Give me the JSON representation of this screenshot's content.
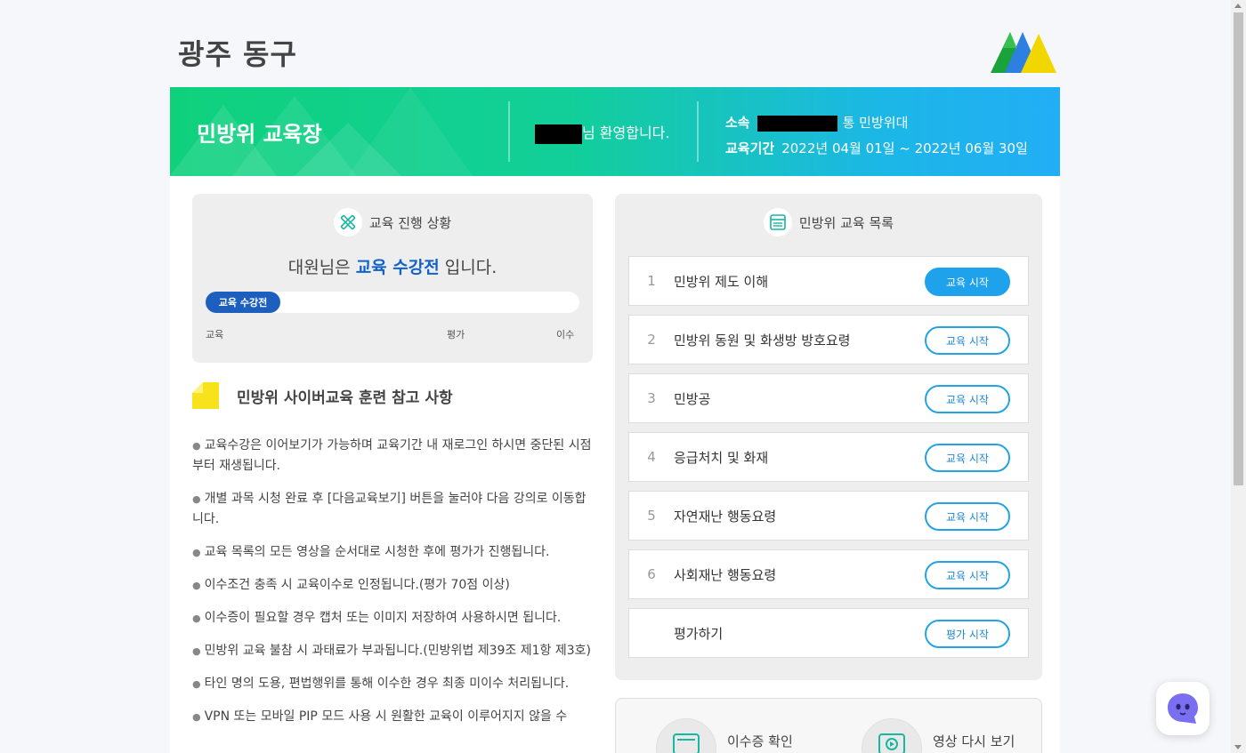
{
  "header": {
    "site_title": "광주 동구"
  },
  "banner": {
    "title": "민방위 교육장",
    "welcome_suffix": "님 환영합니다.",
    "affiliation_label": "소속",
    "affiliation_suffix": "통 민방위대",
    "period_label": "교육기간",
    "period_value": "2022년 04월 01일 ~ 2022년 06월 30일"
  },
  "progress": {
    "heading": "교육 진행 상황",
    "status_prefix": "대원님은 ",
    "status_highlight": "교육 수강전",
    "status_suffix": " 입니다.",
    "bar_label": "교육 수강전",
    "bar_fraction": 0.2,
    "stages": [
      "교육",
      "평가",
      "이수"
    ]
  },
  "notice": {
    "title": "민방위 사이버교육 훈련 참고 사항",
    "items": [
      "교육수강은 이어보기가 가능하며 교육기간 내 재로그인 하시면 중단된 시점부터 재생됩니다.",
      "개별 과목 시청 완료 후 [다음교육보기] 버튼을 눌러야 다음 강의로 이동합니다.",
      "교육 목록의 모든 영상을 순서대로 시청한 후에 평가가 진행됩니다.",
      "이수조건 충족 시 교육이수로 인정됩니다.(평가 70점 이상)",
      "이수증이 필요할 경우 캡처 또는 이미지 저장하여 사용하시면 됩니다.",
      "민방위 교육 불참 시 과태료가 부과됩니다.(민방위법 제39조 제1항 제3호)",
      "타인 명의 도용, 편법행위를 통해 이수한 경우 최종 미이수 처리됩니다.",
      "VPN 또는 모바일 PIP 모드 사용 시 원활한 교육이 이루어지지 않을 수"
    ]
  },
  "courses": {
    "heading": "민방위 교육 목록",
    "items": [
      {
        "num": "1",
        "name": "민방위 제도 이해",
        "button": "교육 시작"
      },
      {
        "num": "2",
        "name": "민방위 동원 및 화생방 방호요령",
        "button": "교육 시작"
      },
      {
        "num": "3",
        "name": "민방공",
        "button": "교육 시작"
      },
      {
        "num": "4",
        "name": "응급처치 및 화재",
        "button": "교육 시작"
      },
      {
        "num": "5",
        "name": "자연재난 행동요령",
        "button": "교육 시작"
      },
      {
        "num": "6",
        "name": "사회재난 행동요령",
        "button": "교육 시작"
      },
      {
        "num": "",
        "name": "평가하기",
        "button": "평가 시작"
      }
    ]
  },
  "bottom": {
    "certificate_label": "이수증 확인",
    "replay_label": "영상 다시 보기"
  },
  "colors": {
    "accent_blue": "#1fa2ec",
    "progress_blue": "#1c5fbf",
    "banner_green": "#0fd17c"
  }
}
